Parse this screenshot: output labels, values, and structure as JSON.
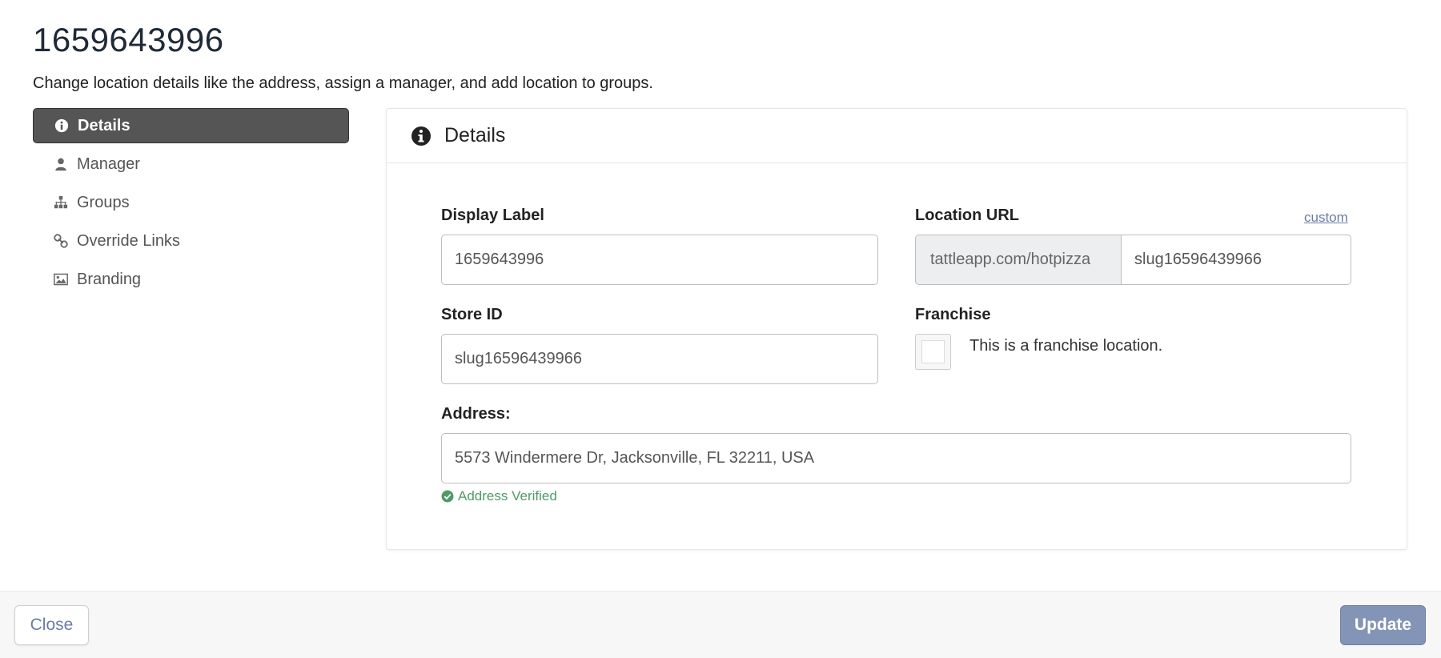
{
  "page": {
    "title": "1659643996",
    "subtitle": "Change location details like the address, assign a manager, and add location to groups."
  },
  "sidebar": {
    "items": [
      {
        "label": "Details",
        "icon": "info-circle-icon",
        "active": true
      },
      {
        "label": "Manager",
        "icon": "user-icon",
        "active": false
      },
      {
        "label": "Groups",
        "icon": "sitemap-icon",
        "active": false
      },
      {
        "label": "Override Links",
        "icon": "link-icon",
        "active": false
      },
      {
        "label": "Branding",
        "icon": "image-icon",
        "active": false
      }
    ]
  },
  "panel": {
    "title": "Details",
    "icon": "info-circle-icon",
    "display_label": {
      "label": "Display Label",
      "value": "1659643996"
    },
    "location_url": {
      "label": "Location URL",
      "custom_link": "custom",
      "prefix": "tattleapp.com/hotpizza",
      "value": "slug16596439966"
    },
    "store_id": {
      "label": "Store ID",
      "value": "slug16596439966"
    },
    "franchise": {
      "label": "Franchise",
      "checkbox_label": "This is a franchise location.",
      "checked": false
    },
    "address": {
      "label": "Address:",
      "value": "5573 Windermere Dr, Jacksonville, FL 32211, USA",
      "status": "Address Verified"
    }
  },
  "footer": {
    "close_label": "Close",
    "update_label": "Update"
  },
  "colors": {
    "active_nav_bg": "#555555",
    "link": "#6b7ba4",
    "verified": "#4f9a68",
    "primary_button": "#8494b7"
  }
}
